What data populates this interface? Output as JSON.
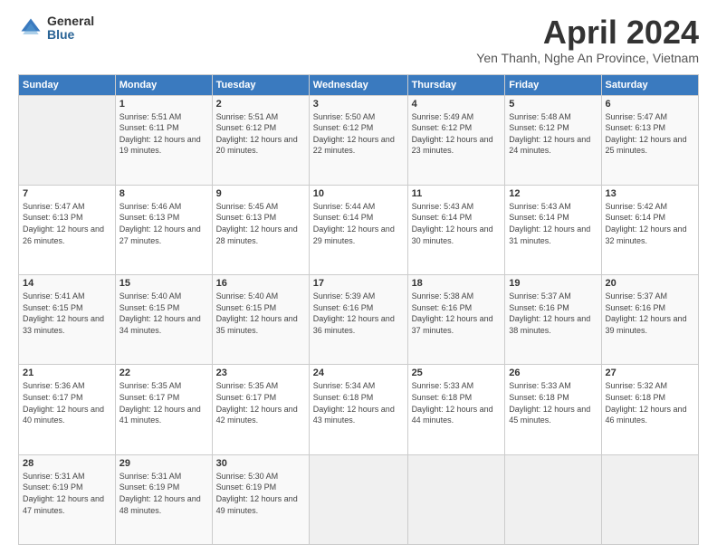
{
  "logo": {
    "general": "General",
    "blue": "Blue"
  },
  "title": "April 2024",
  "subtitle": "Yen Thanh, Nghe An Province, Vietnam",
  "headers": [
    "Sunday",
    "Monday",
    "Tuesday",
    "Wednesday",
    "Thursday",
    "Friday",
    "Saturday"
  ],
  "weeks": [
    [
      {
        "day": "",
        "sunrise": "",
        "sunset": "",
        "daylight": ""
      },
      {
        "day": "1",
        "sunrise": "Sunrise: 5:51 AM",
        "sunset": "Sunset: 6:11 PM",
        "daylight": "Daylight: 12 hours and 19 minutes."
      },
      {
        "day": "2",
        "sunrise": "Sunrise: 5:51 AM",
        "sunset": "Sunset: 6:12 PM",
        "daylight": "Daylight: 12 hours and 20 minutes."
      },
      {
        "day": "3",
        "sunrise": "Sunrise: 5:50 AM",
        "sunset": "Sunset: 6:12 PM",
        "daylight": "Daylight: 12 hours and 22 minutes."
      },
      {
        "day": "4",
        "sunrise": "Sunrise: 5:49 AM",
        "sunset": "Sunset: 6:12 PM",
        "daylight": "Daylight: 12 hours and 23 minutes."
      },
      {
        "day": "5",
        "sunrise": "Sunrise: 5:48 AM",
        "sunset": "Sunset: 6:12 PM",
        "daylight": "Daylight: 12 hours and 24 minutes."
      },
      {
        "day": "6",
        "sunrise": "Sunrise: 5:47 AM",
        "sunset": "Sunset: 6:13 PM",
        "daylight": "Daylight: 12 hours and 25 minutes."
      }
    ],
    [
      {
        "day": "7",
        "sunrise": "Sunrise: 5:47 AM",
        "sunset": "Sunset: 6:13 PM",
        "daylight": "Daylight: 12 hours and 26 minutes."
      },
      {
        "day": "8",
        "sunrise": "Sunrise: 5:46 AM",
        "sunset": "Sunset: 6:13 PM",
        "daylight": "Daylight: 12 hours and 27 minutes."
      },
      {
        "day": "9",
        "sunrise": "Sunrise: 5:45 AM",
        "sunset": "Sunset: 6:13 PM",
        "daylight": "Daylight: 12 hours and 28 minutes."
      },
      {
        "day": "10",
        "sunrise": "Sunrise: 5:44 AM",
        "sunset": "Sunset: 6:14 PM",
        "daylight": "Daylight: 12 hours and 29 minutes."
      },
      {
        "day": "11",
        "sunrise": "Sunrise: 5:43 AM",
        "sunset": "Sunset: 6:14 PM",
        "daylight": "Daylight: 12 hours and 30 minutes."
      },
      {
        "day": "12",
        "sunrise": "Sunrise: 5:43 AM",
        "sunset": "Sunset: 6:14 PM",
        "daylight": "Daylight: 12 hours and 31 minutes."
      },
      {
        "day": "13",
        "sunrise": "Sunrise: 5:42 AM",
        "sunset": "Sunset: 6:14 PM",
        "daylight": "Daylight: 12 hours and 32 minutes."
      }
    ],
    [
      {
        "day": "14",
        "sunrise": "Sunrise: 5:41 AM",
        "sunset": "Sunset: 6:15 PM",
        "daylight": "Daylight: 12 hours and 33 minutes."
      },
      {
        "day": "15",
        "sunrise": "Sunrise: 5:40 AM",
        "sunset": "Sunset: 6:15 PM",
        "daylight": "Daylight: 12 hours and 34 minutes."
      },
      {
        "day": "16",
        "sunrise": "Sunrise: 5:40 AM",
        "sunset": "Sunset: 6:15 PM",
        "daylight": "Daylight: 12 hours and 35 minutes."
      },
      {
        "day": "17",
        "sunrise": "Sunrise: 5:39 AM",
        "sunset": "Sunset: 6:16 PM",
        "daylight": "Daylight: 12 hours and 36 minutes."
      },
      {
        "day": "18",
        "sunrise": "Sunrise: 5:38 AM",
        "sunset": "Sunset: 6:16 PM",
        "daylight": "Daylight: 12 hours and 37 minutes."
      },
      {
        "day": "19",
        "sunrise": "Sunrise: 5:37 AM",
        "sunset": "Sunset: 6:16 PM",
        "daylight": "Daylight: 12 hours and 38 minutes."
      },
      {
        "day": "20",
        "sunrise": "Sunrise: 5:37 AM",
        "sunset": "Sunset: 6:16 PM",
        "daylight": "Daylight: 12 hours and 39 minutes."
      }
    ],
    [
      {
        "day": "21",
        "sunrise": "Sunrise: 5:36 AM",
        "sunset": "Sunset: 6:17 PM",
        "daylight": "Daylight: 12 hours and 40 minutes."
      },
      {
        "day": "22",
        "sunrise": "Sunrise: 5:35 AM",
        "sunset": "Sunset: 6:17 PM",
        "daylight": "Daylight: 12 hours and 41 minutes."
      },
      {
        "day": "23",
        "sunrise": "Sunrise: 5:35 AM",
        "sunset": "Sunset: 6:17 PM",
        "daylight": "Daylight: 12 hours and 42 minutes."
      },
      {
        "day": "24",
        "sunrise": "Sunrise: 5:34 AM",
        "sunset": "Sunset: 6:18 PM",
        "daylight": "Daylight: 12 hours and 43 minutes."
      },
      {
        "day": "25",
        "sunrise": "Sunrise: 5:33 AM",
        "sunset": "Sunset: 6:18 PM",
        "daylight": "Daylight: 12 hours and 44 minutes."
      },
      {
        "day": "26",
        "sunrise": "Sunrise: 5:33 AM",
        "sunset": "Sunset: 6:18 PM",
        "daylight": "Daylight: 12 hours and 45 minutes."
      },
      {
        "day": "27",
        "sunrise": "Sunrise: 5:32 AM",
        "sunset": "Sunset: 6:18 PM",
        "daylight": "Daylight: 12 hours and 46 minutes."
      }
    ],
    [
      {
        "day": "28",
        "sunrise": "Sunrise: 5:31 AM",
        "sunset": "Sunset: 6:19 PM",
        "daylight": "Daylight: 12 hours and 47 minutes."
      },
      {
        "day": "29",
        "sunrise": "Sunrise: 5:31 AM",
        "sunset": "Sunset: 6:19 PM",
        "daylight": "Daylight: 12 hours and 48 minutes."
      },
      {
        "day": "30",
        "sunrise": "Sunrise: 5:30 AM",
        "sunset": "Sunset: 6:19 PM",
        "daylight": "Daylight: 12 hours and 49 minutes."
      },
      {
        "day": "",
        "sunrise": "",
        "sunset": "",
        "daylight": ""
      },
      {
        "day": "",
        "sunrise": "",
        "sunset": "",
        "daylight": ""
      },
      {
        "day": "",
        "sunrise": "",
        "sunset": "",
        "daylight": ""
      },
      {
        "day": "",
        "sunrise": "",
        "sunset": "",
        "daylight": ""
      }
    ]
  ]
}
